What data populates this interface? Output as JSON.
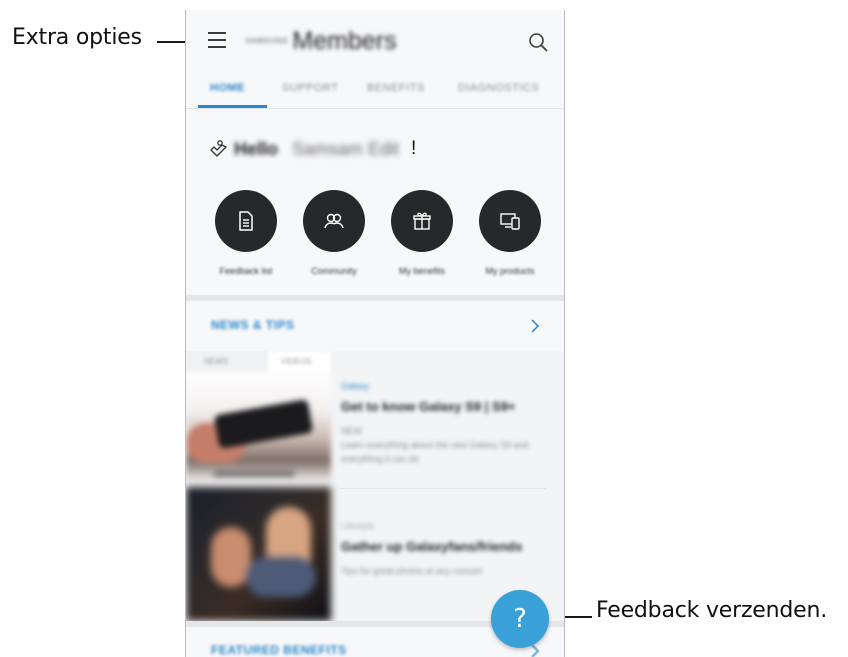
{
  "callouts": {
    "more_options": "Extra opties",
    "send_feedback": "Feedback verzenden."
  },
  "app": {
    "brand_small": "SAMSUNG",
    "brand_title": "Members"
  },
  "tabs": [
    "HOME",
    "SUPPORT",
    "BENEFITS",
    "DIAGNOSTICS"
  ],
  "hello": {
    "greeting": "Hello",
    "name": "Samsam Edit",
    "exclamation": "!"
  },
  "shortcuts": [
    {
      "label": "Feedback list",
      "icon": "document-icon"
    },
    {
      "label": "Community",
      "icon": "community-icon"
    },
    {
      "label": "My benefits",
      "icon": "gift-icon"
    },
    {
      "label": "My products",
      "icon": "devices-icon"
    }
  ],
  "news": {
    "title": "NEWS & TIPS",
    "chips": [
      "NEWS",
      "VIDEOS"
    ],
    "articles": [
      {
        "tag": "Galaxy",
        "title": "Get to know Galaxy S9 | S9+",
        "meta": "NEW",
        "desc_1": "Learn everything about the new Galaxy S9 and",
        "desc_2": "everything it can do",
        "caption": "Get to know Galaxy"
      },
      {
        "tag": "Lifestyle",
        "title": "Gather up Galaxyfans/friends",
        "meta": "",
        "desc_1": "Tips for great photos at any concert",
        "desc_2": ""
      }
    ]
  },
  "featured": {
    "title": "FEATURED BENEFITS"
  },
  "fab": {
    "symbol": "?"
  },
  "colors": {
    "accent": "#2a86c8",
    "fab": "#3aa0d8",
    "circle_button": "#262829"
  }
}
